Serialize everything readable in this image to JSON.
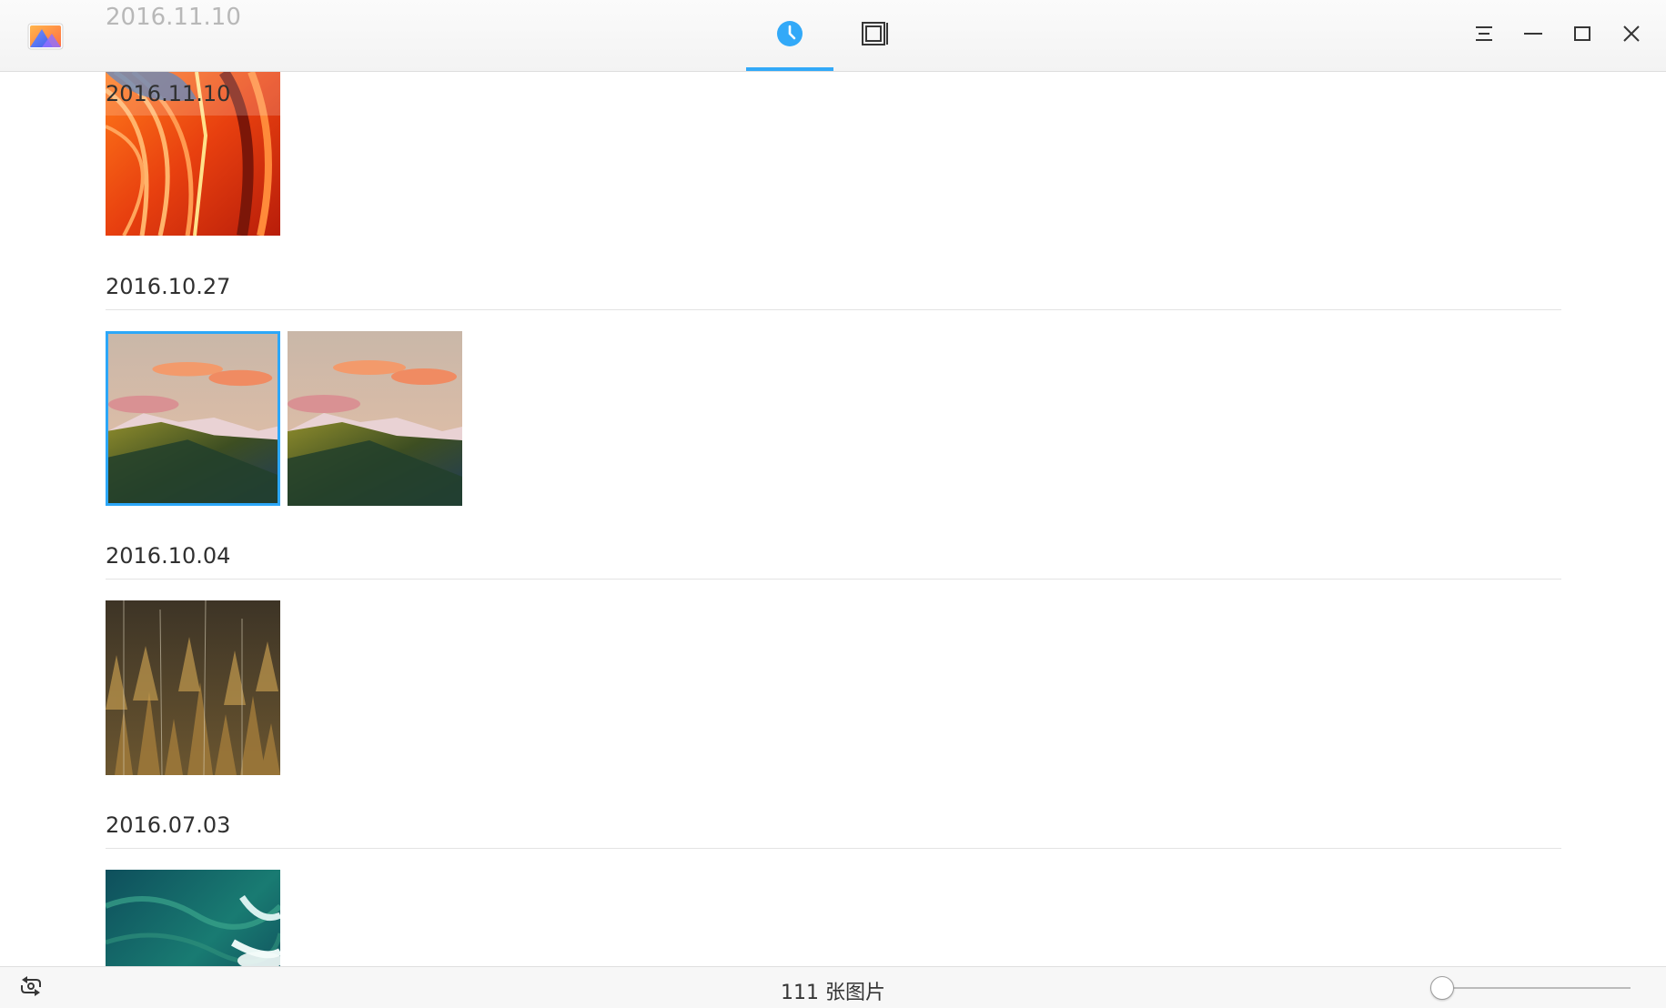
{
  "titlebar": {
    "app_icon": "deepin-image-viewer-icon",
    "scrolled_date": "2016.11.10",
    "tabs": [
      {
        "name": "timeline",
        "icon": "clock-icon",
        "active": true
      },
      {
        "name": "albums",
        "icon": "album-icon",
        "active": false
      }
    ],
    "window_buttons": [
      "menu-icon",
      "minimize-icon",
      "maximize-icon",
      "close-icon"
    ]
  },
  "timeline": {
    "groups": [
      {
        "date": "2016.11.10",
        "photos": [
          {
            "desc": "orange-swirl",
            "selected": false
          }
        ]
      },
      {
        "date": "2016.10.27",
        "photos": [
          {
            "desc": "mountain-sunset",
            "selected": true
          },
          {
            "desc": "mountain-sunset",
            "selected": false
          }
        ]
      },
      {
        "date": "2016.10.04",
        "photos": [
          {
            "desc": "autumn-forest",
            "selected": false
          }
        ]
      },
      {
        "date": "2016.07.03",
        "photos": [
          {
            "desc": "ocean-wave",
            "selected": false
          }
        ]
      }
    ]
  },
  "statusbar": {
    "import_icon": "import-icon",
    "photo_count": "111 张图片",
    "zoom_level": 0
  },
  "colors": {
    "accent": "#2ca7f8",
    "text": "#303030",
    "separator": "#e3e3e3"
  }
}
